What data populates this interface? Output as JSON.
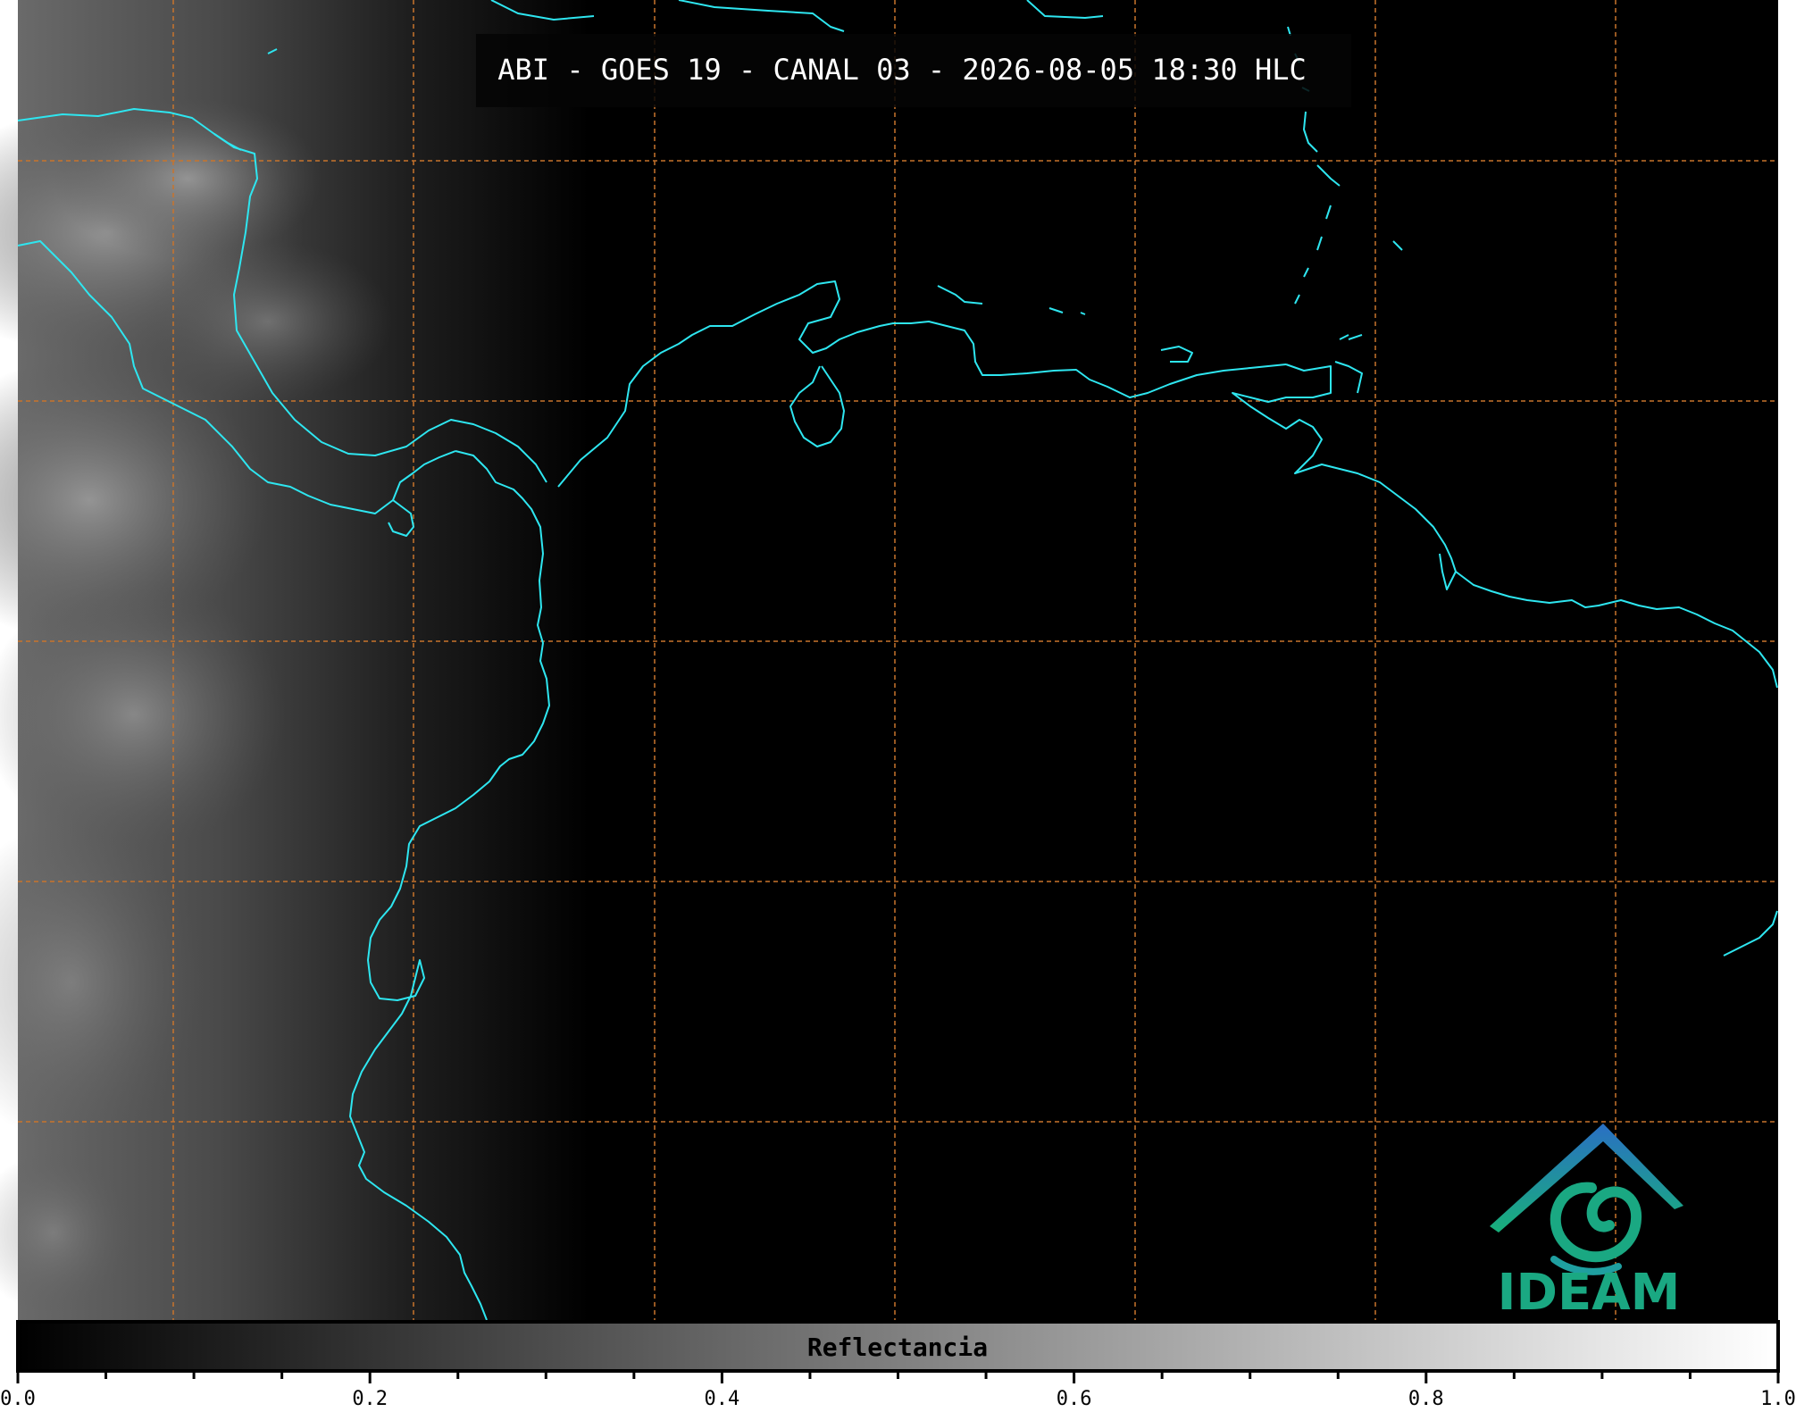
{
  "map": {
    "title": "ABI - GOES 19 - CANAL 03 - 2026-08-05 18:30 HLC",
    "coastline_color": "#2ee6f0",
    "grid_color": "#c8742c",
    "background_color": "#000000",
    "grid_style": "dashed",
    "grid_lines": "on"
  },
  "logo": {
    "text": "IDEAM",
    "primary_color": "#1aa882",
    "secondary_color": "#2a7bc0"
  },
  "colorbar": {
    "label": "Reflectancia",
    "range": [
      0.0,
      1.0
    ],
    "colormap": "grayscale",
    "ticks": [
      "0.0",
      "0.2",
      "0.4",
      "0.6",
      "0.8",
      "1.0"
    ]
  }
}
